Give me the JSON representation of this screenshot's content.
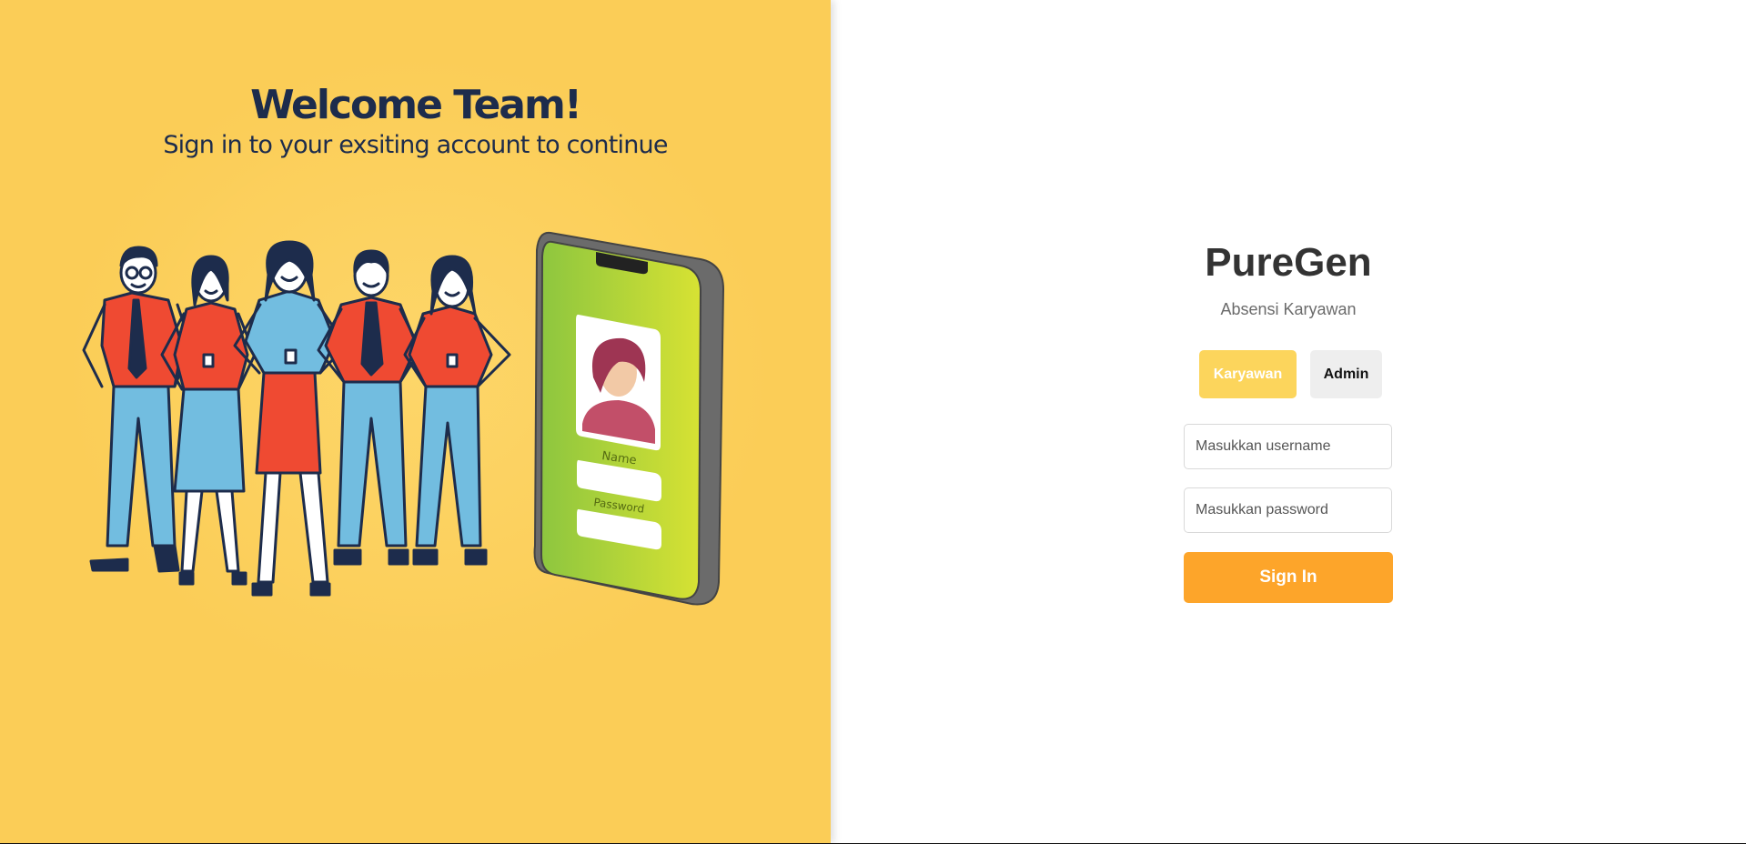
{
  "hero": {
    "title": "Welcome Team!",
    "subtitle": "Sign in to your exsiting account to continue",
    "phone_labels": {
      "name": "Name",
      "password": "Password"
    }
  },
  "login": {
    "app_name": "PureGen",
    "app_subtitle": "Absensi Karyawan",
    "roles": [
      {
        "label": "Karyawan",
        "selected": true
      },
      {
        "label": "Admin",
        "selected": false
      }
    ],
    "username_placeholder": "Masukkan username",
    "password_placeholder": "Masukkan password",
    "signin_label": "Sign In"
  },
  "colors": {
    "left_bg": "#fbcd57",
    "accent": "#fda52a",
    "tab_active": "#fcd55c",
    "heading_navy": "#1d2c4c"
  }
}
